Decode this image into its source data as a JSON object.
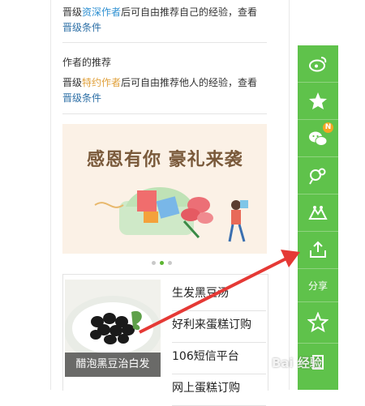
{
  "section1": {
    "line1_pre": "晋级",
    "line1_link": "资深作者",
    "line1_post": "后可自由推荐自己的经验，查看",
    "line2_link": "晋级条件"
  },
  "section2": {
    "title": "作者的推荐",
    "line1_pre": "晋级",
    "line1_link": "特约作者",
    "line1_post": "后可自由推荐他人的经验，查看",
    "line2_link": "晋级条件"
  },
  "banner": {
    "text": "感恩有你 豪礼来袭"
  },
  "carousel": {
    "active_index": 1,
    "total": 3
  },
  "ad": {
    "image_caption": "醋泡黑豆治白发",
    "items": [
      "生发黑豆汤",
      "好利来蛋糕订购",
      "106短信平台",
      "网上蛋糕订购"
    ]
  },
  "sidebar": {
    "buttons": [
      {
        "icon": "weibo-icon"
      },
      {
        "icon": "star-badge-icon"
      },
      {
        "icon": "wechat-icon",
        "badge": "N"
      },
      {
        "icon": "tieba-icon"
      },
      {
        "icon": "team-icon"
      },
      {
        "icon": "share-upload-icon"
      }
    ],
    "share_label": "分享"
  },
  "watermark": "Bai 经验"
}
